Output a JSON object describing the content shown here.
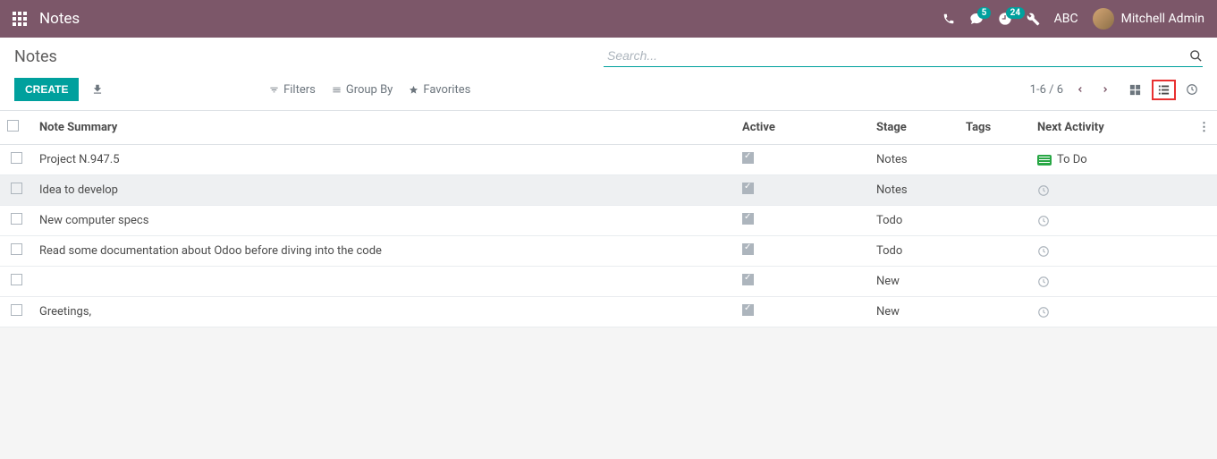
{
  "navbar": {
    "app_name": "Notes",
    "messages_badge": "5",
    "activities_badge": "24",
    "company": "ABC",
    "user_name": "Mitchell Admin"
  },
  "control": {
    "page_title": "Notes",
    "search_placeholder": "Search...",
    "create_label": "CREATE",
    "filters_label": "Filters",
    "groupby_label": "Group By",
    "favorites_label": "Favorites",
    "pager_text": "1-6 / 6"
  },
  "table": {
    "headers": {
      "summary": "Note Summary",
      "active": "Active",
      "stage": "Stage",
      "tags": "Tags",
      "next": "Next Activity"
    },
    "rows": [
      {
        "summary": "Project N.947.5",
        "active": true,
        "stage": "Notes",
        "tags": "",
        "next_activity": "To Do",
        "activity_type": "todo"
      },
      {
        "summary": "Idea to develop",
        "active": true,
        "stage": "Notes",
        "tags": "",
        "next_activity": "",
        "activity_type": "clock",
        "hovered": true
      },
      {
        "summary": "New computer specs",
        "active": true,
        "stage": "Todo",
        "tags": "",
        "next_activity": "",
        "activity_type": "clock"
      },
      {
        "summary": "Read some documentation about Odoo before diving into the code",
        "active": true,
        "stage": "Todo",
        "tags": "",
        "next_activity": "",
        "activity_type": "clock"
      },
      {
        "summary": "",
        "active": true,
        "stage": "New",
        "tags": "",
        "next_activity": "",
        "activity_type": "clock"
      },
      {
        "summary": "Greetings,",
        "active": true,
        "stage": "New",
        "tags": "",
        "next_activity": "",
        "activity_type": "clock"
      }
    ]
  }
}
